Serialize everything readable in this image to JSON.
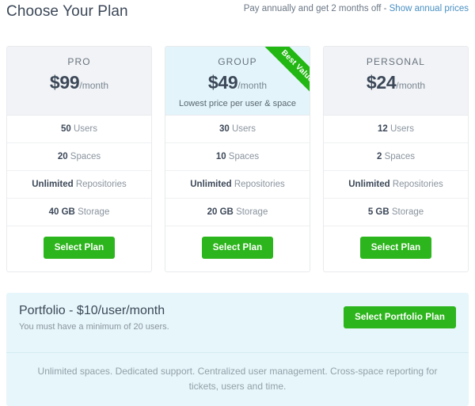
{
  "header": {
    "title": "Choose Your Plan",
    "annual_note": "Pay annually and get 2 months off - ",
    "annual_link": "Show annual prices"
  },
  "plans": [
    {
      "name": "PRO",
      "price": "$99",
      "period": "/month",
      "subtitle": "",
      "badge": "",
      "features": [
        {
          "value": "50",
          "label": " Users"
        },
        {
          "value": "20",
          "label": " Spaces"
        },
        {
          "value": "Unlimited",
          "label": " Repositories"
        },
        {
          "value": "40 GB",
          "label": " Storage"
        }
      ],
      "cta": "Select Plan"
    },
    {
      "name": "GROUP",
      "price": "$49",
      "period": "/month",
      "subtitle": "Lowest price per user & space",
      "badge": "Best Value",
      "features": [
        {
          "value": "30",
          "label": " Users"
        },
        {
          "value": "10",
          "label": " Spaces"
        },
        {
          "value": "Unlimited",
          "label": " Repositories"
        },
        {
          "value": "20 GB",
          "label": " Storage"
        }
      ],
      "cta": "Select Plan"
    },
    {
      "name": "PERSONAL",
      "price": "$24",
      "period": "/month",
      "subtitle": "",
      "badge": "",
      "features": [
        {
          "value": "12",
          "label": " Users"
        },
        {
          "value": "2",
          "label": " Spaces"
        },
        {
          "value": "Unlimited",
          "label": " Repositories"
        },
        {
          "value": "5 GB",
          "label": " Storage"
        }
      ],
      "cta": "Select Plan"
    }
  ],
  "portfolio": {
    "title": "Portfolio - $10/user/month",
    "subtitle": "You must have a minimum of 20 users.",
    "cta": "Select Portfolio Plan",
    "description": "Unlimited spaces. Dedicated support. Centralized user management. Cross-space reporting for tickets, users and time."
  },
  "colors": {
    "green": "#2cb51c",
    "ribbon_green": "#22b712",
    "link_blue": "#4a90c2",
    "featured_bg": "#e3f5fb",
    "card_head_bg": "#f1f3f6",
    "portfolio_bg": "#e6f6fa"
  }
}
